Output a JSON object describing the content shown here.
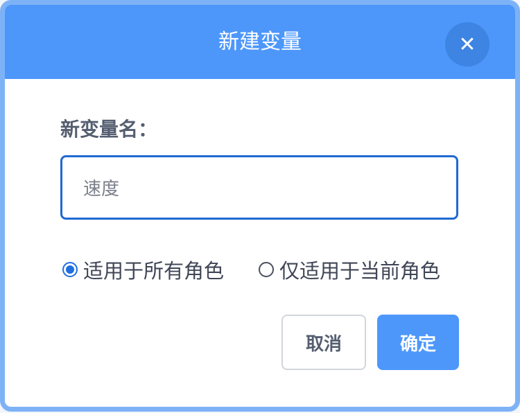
{
  "dialog": {
    "title": "新建变量",
    "close_icon": "close-icon"
  },
  "form": {
    "label": "新变量名：",
    "input_value": "速度"
  },
  "scope": {
    "options": [
      {
        "label": "适用于所有角色",
        "checked": true
      },
      {
        "label": "仅适用于当前角色",
        "checked": false
      }
    ]
  },
  "buttons": {
    "cancel": "取消",
    "ok": "确定"
  },
  "colors": {
    "accent": "#4d97fb",
    "input_border": "#1f69d2",
    "text": "#545e70"
  }
}
